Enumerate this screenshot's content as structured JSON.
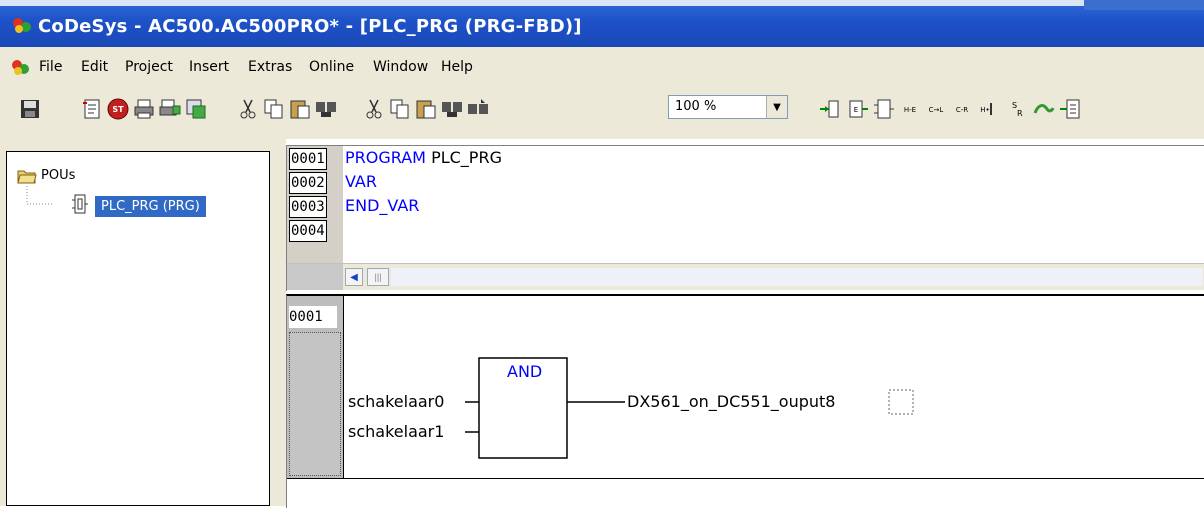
{
  "window": {
    "title": "CoDeSys - AC500.AC500PRO* - [PLC_PRG (PRG-FBD)]"
  },
  "menu": [
    "File",
    "Edit",
    "Project",
    "Insert",
    "Extras",
    "Online",
    "Window",
    "Help"
  ],
  "toolbar": {
    "zoom_value": "100 %",
    "icons": [
      "save-icon",
      "declare-icon",
      "stop-icon",
      "print-icon",
      "print-setup-icon",
      "find-icon",
      "cut-icon",
      "copy-icon",
      "paste-icon",
      "find-next-icon",
      "cut-icon-2",
      "copy-icon-2",
      "paste-icon-2",
      "find-icon-2",
      "replace-icon",
      "box-icon",
      "input-icon",
      "output-icon",
      "contact-icon",
      "coil-icon",
      "negated-coil-icon",
      "jump-icon",
      "set-reset-icon",
      "return-icon",
      "comment-icon"
    ]
  },
  "tree": {
    "root_label": "POUs",
    "child_label": "PLC_PRG (PRG)"
  },
  "declaration": {
    "line_numbers": [
      "0001",
      "0002",
      "0003",
      "0004"
    ],
    "lines": [
      {
        "keyword": "PROGRAM",
        "ident": " PLC_PRG"
      },
      {
        "keyword": "VAR",
        "ident": ""
      },
      {
        "keyword": "END_VAR",
        "ident": ""
      },
      {
        "keyword": "",
        "ident": ""
      }
    ]
  },
  "fbd": {
    "network_number": "0001",
    "block_name": "AND",
    "input_1": "schakelaar0",
    "input_2": "schakelaar1",
    "output": "DX561_on_DC551_ouput8"
  }
}
